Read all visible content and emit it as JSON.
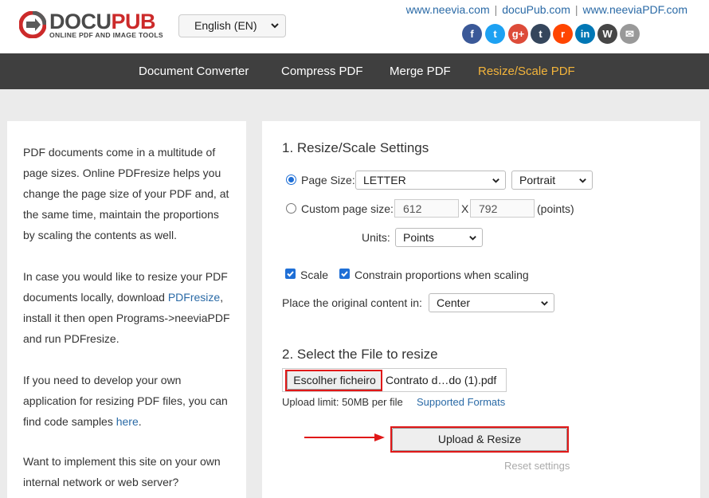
{
  "brand": {
    "name_left": "DOCU",
    "name_right": "PUB",
    "tagline": "ONLINE PDF AND IMAGE TOOLS",
    "accent": "#cc2a2a"
  },
  "language": {
    "selected": "English (EN)"
  },
  "top_links": [
    "www.neevia.com",
    "docuPub.com",
    "www.neeviaPDF.com"
  ],
  "social": [
    {
      "icon": "facebook-icon",
      "glyph": "f",
      "color": "#3b5998"
    },
    {
      "icon": "twitter-icon",
      "glyph": "t",
      "color": "#1da1f2"
    },
    {
      "icon": "google-plus-icon",
      "glyph": "g+",
      "color": "#dd4b39"
    },
    {
      "icon": "tumblr-icon",
      "glyph": "t",
      "color": "#35465c"
    },
    {
      "icon": "reddit-icon",
      "glyph": "r",
      "color": "#ff4500"
    },
    {
      "icon": "linkedin-icon",
      "glyph": "in",
      "color": "#0077b5"
    },
    {
      "icon": "wordpress-icon",
      "glyph": "W",
      "color": "#464646"
    },
    {
      "icon": "email-icon",
      "glyph": "✉",
      "color": "#999999"
    }
  ],
  "nav": {
    "items": [
      "Document Converter",
      "Compress PDF",
      "Merge PDF",
      "Resize/Scale PDF"
    ],
    "active": "Resize/Scale PDF",
    "active_color": "#f3b43b"
  },
  "intro": {
    "p1": "PDF documents come in a multitude of page sizes. Online PDFresize helps you change the page size of your PDF and, at the same time, maintain the proportions by scaling the contents as well.",
    "p2_before": "In case you would like to resize your PDF documents locally, download ",
    "p2_link": "PDFresize",
    "p2_after": ", install it then open Programs->neeviaPDF and run PDFresize.",
    "p3_before": "If you need to develop your own application for resizing PDF files, you can find code samples ",
    "p3_link": "here",
    "p3_after": ".",
    "p4": "Want to implement this site on your own internal network or web server?"
  },
  "settings": {
    "title": "1. Resize/Scale Settings",
    "page_size_label": "Page Size:",
    "page_size_value": "LETTER",
    "orientation_value": "Portrait",
    "custom_label": "Custom page size:",
    "width_placeholder": "612",
    "height_placeholder": "792",
    "x_label": "X",
    "points_label": "(points)",
    "units_label": "Units:",
    "units_value": "Points",
    "scale_label": "Scale",
    "constrain_label": "Constrain proportions when scaling",
    "place_label": "Place the original content in:",
    "place_value": "Center"
  },
  "file": {
    "title": "2. Select the File to resize",
    "choose_label": "Escolher ficheiro",
    "file_name": "Contrato d…do (1).pdf",
    "limit_label": "Upload limit: 50MB per file",
    "formats_label": "Supported Formats",
    "upload_label": "Upload & Resize",
    "reset_label": "Reset settings"
  },
  "colors": {
    "nav_bg": "#3f3f3f",
    "link": "#2a6aa6",
    "highlight": "#e01818",
    "checkbox": "#1f6fd6"
  }
}
